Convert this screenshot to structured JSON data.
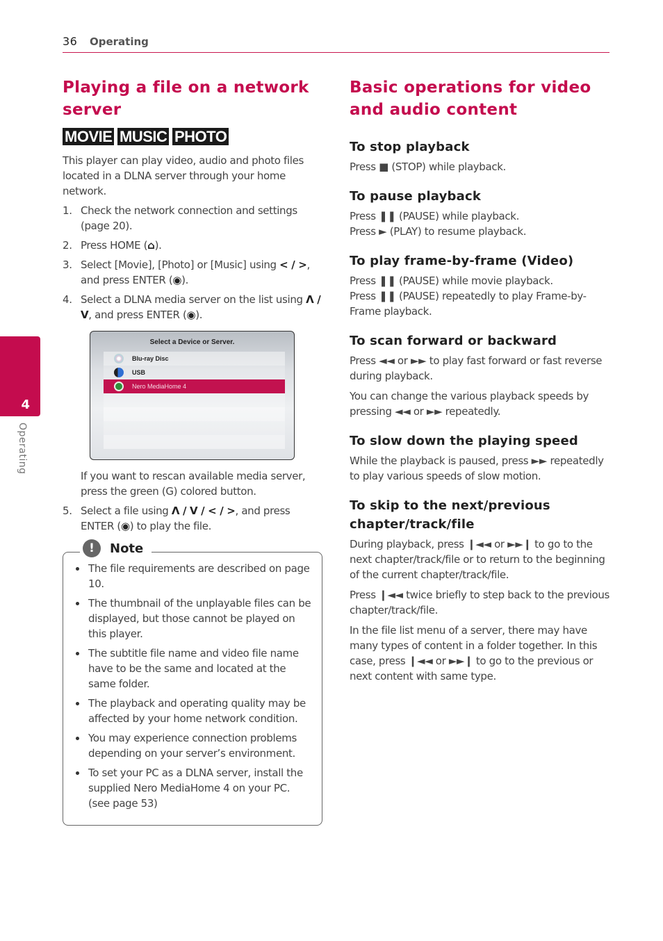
{
  "header": {
    "page_number": "36",
    "section": "Operating"
  },
  "side_tab": {
    "chapter_number": "4",
    "chapter_label": "Operating"
  },
  "left": {
    "title": "Playing a file on a network server",
    "badges": [
      "MOVIE",
      "MUSIC",
      "PHOTO"
    ],
    "intro": "This player can play video, audio and photo files located in a DLNA server through your home network.",
    "steps": [
      {
        "n": "1.",
        "text": "Check the network connection and settings (page 20)."
      },
      {
        "n": "2.",
        "pre": "Press HOME (",
        "icon": "⌂",
        "post": ")."
      },
      {
        "n": "3.",
        "pre": "Select [Movie], [Photo] or [Music] using ",
        "keys": "< / >",
        "mid": ", and press ENTER (",
        "icon": "◉",
        "post": ")."
      },
      {
        "n": "4.",
        "pre": "Select a DLNA media server on the list using ",
        "keys": "Λ / V",
        "mid": ", and press ENTER (",
        "icon": "◉",
        "post": ")."
      }
    ],
    "screen": {
      "title": "Select a Device or Server.",
      "items": [
        {
          "label": "Blu-ray Disc",
          "icon": "disc-icon",
          "selected": false
        },
        {
          "label": "USB",
          "icon": "usb-icon",
          "selected": false
        },
        {
          "label": "Nero MediaHome 4",
          "icon": "nero-server-icon",
          "selected": true
        }
      ]
    },
    "rescan": "If you want to rescan available media server, press the green (G) colored button.",
    "step5": {
      "n": "5.",
      "pre": "Select a file using ",
      "keys": "Λ / V / < / >",
      "mid": ", and press ENTER (",
      "icon": "◉",
      "post": ") to play the file."
    },
    "note": {
      "label": "Note",
      "icon": "!",
      "items": [
        "The file requirements are described on page 10.",
        "The thumbnail of the unplayable files can be displayed, but those cannot be played on this player.",
        "The subtitle file name and video file name have to be the same and located at the same folder.",
        "The playback and operating quality may be affected by your home network condition.",
        "You may experience connection problems depending on your server’s environment.",
        "To set your PC as a DLNA server, install the supplied Nero MediaHome 4 on your PC. (see page 53)"
      ]
    }
  },
  "right": {
    "title": "Basic operations for video and audio content",
    "sections": [
      {
        "heading": "To stop playback",
        "paras": [
          {
            "lines": [
              "Press ■ (STOP) while playback."
            ]
          }
        ]
      },
      {
        "heading": "To pause playback",
        "paras": [
          {
            "lines": [
              "Press ❚❚ (PAUSE) while playback.",
              "Press ► (PLAY) to resume playback."
            ]
          }
        ]
      },
      {
        "heading": "To play frame-by-frame (Video)",
        "paras": [
          {
            "lines": [
              "Press ❚❚ (PAUSE) while movie playback.",
              "Press ❚❚ (PAUSE) repeatedly to play Frame-by-Frame playback."
            ]
          }
        ]
      },
      {
        "heading": "To scan forward or backward",
        "paras": [
          {
            "lines": [
              "Press ◄◄ or ►► to play fast forward or fast reverse during playback."
            ]
          },
          {
            "lines": [
              "You can change the various playback speeds by pressing ◄◄ or ►► repeatedly."
            ]
          }
        ]
      },
      {
        "heading": "To slow down the playing speed",
        "paras": [
          {
            "lines": [
              "While the playback is paused, press ►► repeatedly to play various speeds of slow motion."
            ]
          }
        ]
      },
      {
        "heading": "To skip to the next/previous chapter/track/file",
        "paras": [
          {
            "lines": [
              "During playback, press ❙◄◄ or ►►❙ to go to the next chapter/track/file or to return to the beginning of the current chapter/track/file."
            ]
          },
          {
            "lines": [
              "Press ❙◄◄ twice briefly to step back to the previous chapter/track/file."
            ]
          },
          {
            "lines": [
              "In the file list menu of a server, there may have many types of content in a folder together. In this case, press ❙◄◄ or ►►❙ to go to the previous or next content with same type."
            ]
          }
        ]
      }
    ]
  },
  "colors": {
    "accent": "#c40c4e",
    "heading": "#222222",
    "body": "#444444"
  }
}
